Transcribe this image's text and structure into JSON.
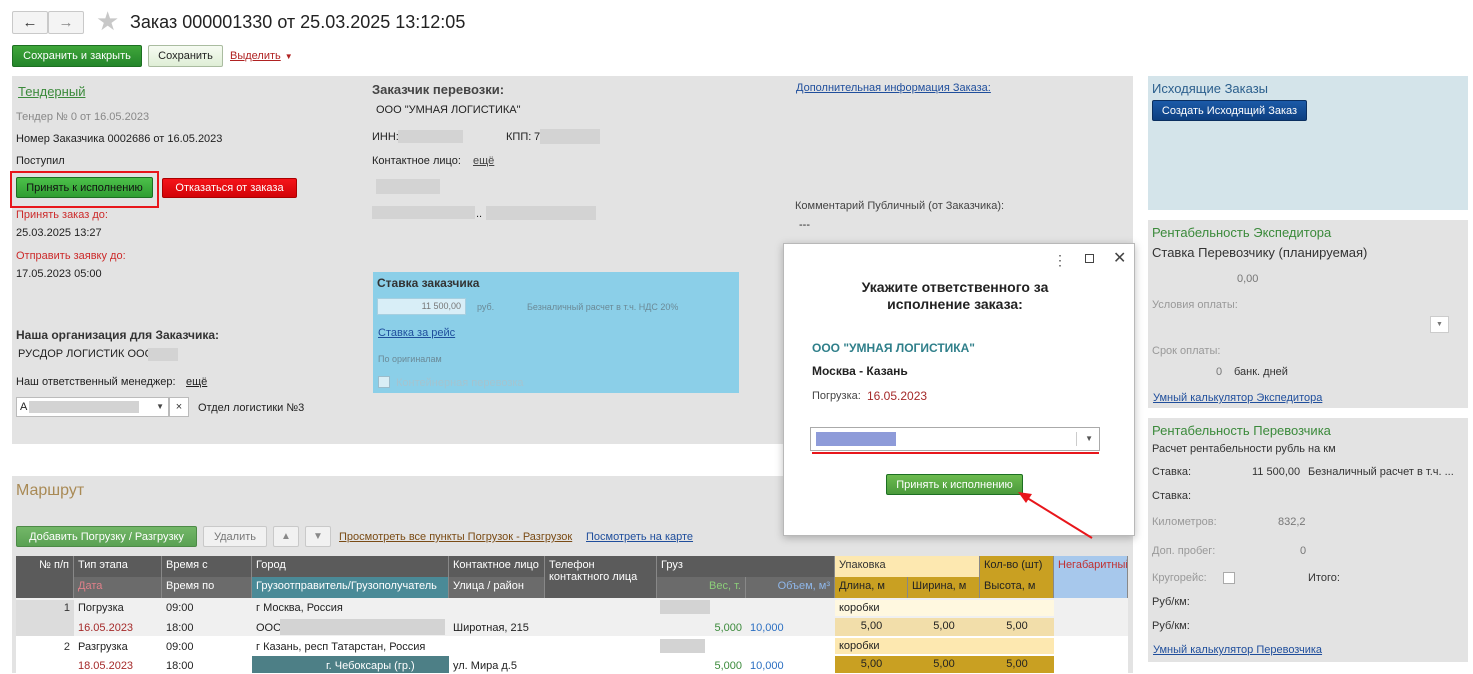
{
  "window": {
    "title": "Заказ 000001330 от 25.03.2025 13:12:05",
    "back": "←",
    "forward": "→",
    "star": "★"
  },
  "toolbar": {
    "save_close": "Сохранить и закрыть",
    "save": "Сохранить",
    "select": "Выделить"
  },
  "tender": {
    "link": "Тендерный",
    "tender_no": "Тендер № 0 от 16.05.2023",
    "customer_no": "Номер Заказчика 0002686 от 16.05.2023",
    "status": "Поступил",
    "accept": "Принять к исполнению",
    "decline": "Отказаться от заказа",
    "accept_until_label": "Принять заказ до:",
    "accept_until": "25.03.2025 13:27",
    "send_until_label": "Отправить заявку до:",
    "send_until": "17.05.2023 05:00",
    "our_org_label": "Наша организация для Заказчика:",
    "our_org": "РУСДОР ЛОГИСТИК ООО",
    "manager_label": "Наш ответственный менеджер:",
    "manager_more": "ещё",
    "manager_value": "А",
    "department": "Отдел логистики №3",
    "clear": "×"
  },
  "customer": {
    "title": "Заказчик перевозки:",
    "name": "ООО \"УМНАЯ ЛОГИСТИКА\"",
    "inn_label": "ИНН:",
    "kpp_label": "КПП:",
    "kpp_value": "7",
    "contact_label": "Контактное лицо:",
    "contact_more": "ещё",
    "phone_sep": ".."
  },
  "rate": {
    "title": "Ставка заказчика",
    "amount": "11 500,00",
    "currency": "руб.",
    "payment": "Безналичный расчет в т.ч. НДС 20%",
    "per_trip": "Ставка за рейс",
    "originals": "По оригиналам",
    "container": "Контейнерная перевозка"
  },
  "info": {
    "extra_link": "Дополнительная информация Заказа:",
    "comment_label": "Комментарий Публичный (от Заказчика):",
    "comment_value": "---"
  },
  "outgoing": {
    "title": "Исходящие Заказы",
    "create": "Создать Исходящий Заказ"
  },
  "expeditor": {
    "title": "Рентабельность Экспедитора",
    "rate_label": "Ставка Перевозчику (планируемая)",
    "rate_value": "0,00",
    "pay_terms": "Условия оплаты:",
    "pay_period": "Срок оплаты:",
    "days": "0",
    "days_unit": "банк. дней",
    "calc": "Умный калькулятор Экспедитора"
  },
  "carrier": {
    "title": "Рентабельность Перевозчика",
    "subtitle": "Расчет рентабельности рубль на км",
    "rate_label": "Ставка:",
    "rate_value": "11 500,00",
    "rate_note": "Безналичный расчет в т.ч. ...",
    "rate2_label": "Ставка:",
    "km_label": "Километров:",
    "km_value": "832,2",
    "extra_label": "Доп. пробег:",
    "extra_value": "0",
    "round_label": "Кругорейс:",
    "total_label": "Итого:",
    "rubkm1": "Руб/км:",
    "rubkm2": "Руб/км:",
    "calc": "Умный калькулятор Перевозчика"
  },
  "route": {
    "title": "Маршрут",
    "add": "Добавить Погрузку / Разгрузку",
    "delete": "Удалить",
    "view_points": "Просмотреть все пункты Погрузок - Разгрузок",
    "view_map": "Посмотреть на карте",
    "headers": {
      "no": "№ п/п",
      "stage": "Тип этапа",
      "date": "Дата",
      "time_from": "Время с",
      "time_to": "Время по",
      "city": "Город",
      "shipper": "Грузоотправитель/Грузополучатель",
      "contact": "Контактное лицо",
      "street": "Улица / район",
      "phone": "Телефон контактного лица",
      "cargo": "Груз",
      "weight": "Вес, т.",
      "volume": "Объем, м³",
      "pack": "Упаковка",
      "length": "Длина, м",
      "width": "Ширина, м",
      "qty": "Кол-во (шт)",
      "height": "Высота, м",
      "oversize": "Негабаритный"
    },
    "rows": [
      {
        "no": "1",
        "stage": "Погрузка",
        "date": "16.05.2023",
        "time_from": "09:00",
        "time_to": "18:00",
        "city": "г Москва, Россия",
        "shipper": "ООО",
        "street": "Широтная, 215",
        "weight": "5,000",
        "volume": "10,000",
        "pack": "коробки",
        "length": "5,00",
        "width": "5,00",
        "height": "5,00"
      },
      {
        "no": "2",
        "stage": "Разгрузка",
        "date": "18.05.2023",
        "time_from": "09:00",
        "time_to": "18:00",
        "city": "г Казань, респ Татарстан, Россия",
        "shipper": "г. Чебоксары (гр.)",
        "street": "ул. Мира д.5",
        "weight": "5,000",
        "volume": "10,000",
        "pack": "коробки",
        "length": "5,00",
        "width": "5,00",
        "height": "5,00"
      }
    ]
  },
  "dialog": {
    "title": "Укажите ответственного за исполнение заказа:",
    "company": "ООО \"УМНАЯ ЛОГИСТИКА\"",
    "route": "Москва - Казань",
    "load_label": "Погрузка:",
    "load_date": "16.05.2023",
    "accept": "Принять к исполнению"
  },
  "colors": {
    "accent_green": "#24852a",
    "red": "#d20308",
    "blue": "#0d3f80",
    "highlight_red": "#e8161b"
  }
}
